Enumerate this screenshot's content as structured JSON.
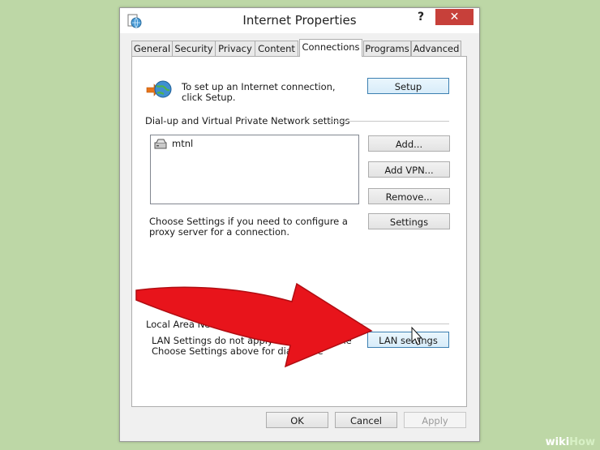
{
  "window": {
    "title": "Internet Properties",
    "help_label": "?",
    "close_label": "✕"
  },
  "tabs": [
    "General",
    "Security",
    "Privacy",
    "Content",
    "Connections",
    "Programs",
    "Advanced"
  ],
  "active_tab": "Connections",
  "connections": {
    "setup_text": "To set up an Internet connection, click Setup.",
    "setup_button": "Setup",
    "dialup_group_label": "Dial-up and Virtual Private Network settings",
    "connections_list": [
      "mtnl"
    ],
    "add_button": "Add...",
    "add_vpn_button": "Add VPN...",
    "remove_button": "Remove...",
    "proxy_text": "Choose Settings if you need to configure a proxy server for a connection.",
    "settings_button": "Settings",
    "lan_group_label": "Local Area Network (LAN) settings",
    "lan_text_line1": "LAN Settings do not apply to dial-up conne",
    "lan_text_line2": "Choose Settings above for dial-up se",
    "lan_settings_button": "LAN settings"
  },
  "footer": {
    "ok_button": "OK",
    "cancel_button": "Cancel",
    "apply_button": "Apply"
  },
  "watermark": {
    "part1": "wiki",
    "part2": "How"
  },
  "colors": {
    "background": "#bdd7a6",
    "close_button": "#c7403a",
    "annotation_arrow": "#e8141b",
    "focus_border": "#3c7fb1"
  },
  "icons": {
    "app": "internet-globe-icon",
    "setup": "network-globe-arrow-icon",
    "connection": "dialup-modem-icon",
    "cursor": "mouse-pointer-icon"
  }
}
